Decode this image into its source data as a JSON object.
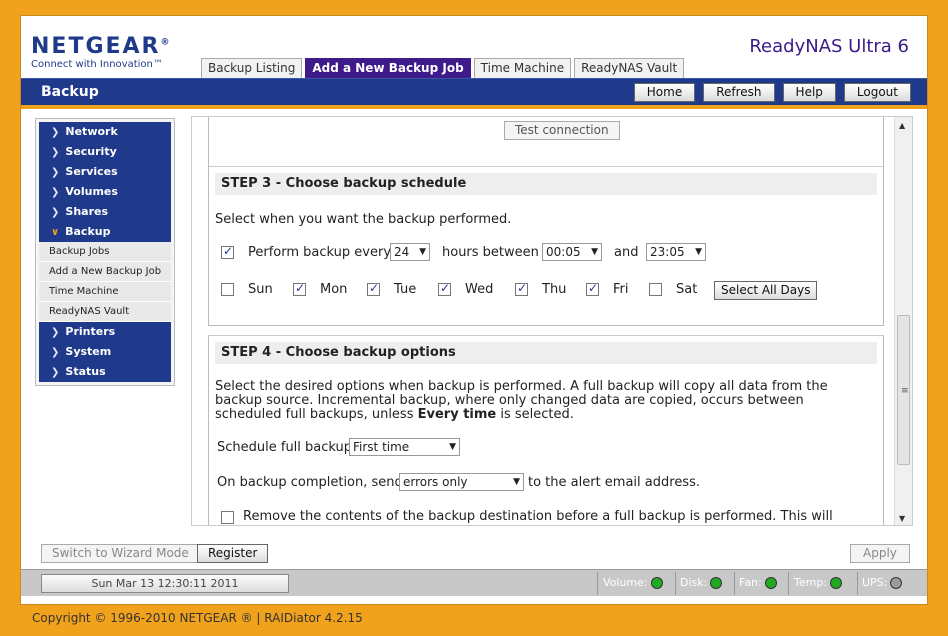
{
  "header": {
    "brand": "NETGEAR",
    "registered": "®",
    "tagline": "Connect with Innovation™",
    "product": "ReadyNAS Ultra 6"
  },
  "tabs": [
    {
      "label": "Backup Listing",
      "active": false
    },
    {
      "label": "Add a New Backup Job",
      "active": true
    },
    {
      "label": "Time Machine",
      "active": false
    },
    {
      "label": "ReadyNAS Vault",
      "active": false
    }
  ],
  "titlebar": {
    "section": "Backup",
    "buttons": [
      "Home",
      "Refresh",
      "Help",
      "Logout"
    ]
  },
  "sidebar": {
    "items": [
      {
        "label": "Network",
        "type": "main"
      },
      {
        "label": "Security",
        "type": "main"
      },
      {
        "label": "Services",
        "type": "main"
      },
      {
        "label": "Volumes",
        "type": "main"
      },
      {
        "label": "Shares",
        "type": "main"
      },
      {
        "label": "Backup",
        "type": "main",
        "open": true
      },
      {
        "label": "Backup Jobs",
        "type": "sub"
      },
      {
        "label": "Add a New Backup Job",
        "type": "sub"
      },
      {
        "label": "Time Machine",
        "type": "sub"
      },
      {
        "label": "ReadyNAS Vault",
        "type": "sub"
      },
      {
        "label": "Printers",
        "type": "main"
      },
      {
        "label": "System",
        "type": "main"
      },
      {
        "label": "Status",
        "type": "main"
      }
    ]
  },
  "test_connection": "Test connection",
  "step3": {
    "title": "STEP 3 - Choose backup schedule",
    "instruction": "Select when you want the backup performed.",
    "perform_label": "Perform backup every",
    "perform_checked": true,
    "interval": "24",
    "hours_between": "hours between",
    "start_time": "00:05",
    "and": "and",
    "end_time": "23:05",
    "days": [
      {
        "label": "Sun",
        "checked": false
      },
      {
        "label": "Mon",
        "checked": true
      },
      {
        "label": "Tue",
        "checked": true
      },
      {
        "label": "Wed",
        "checked": true
      },
      {
        "label": "Thu",
        "checked": true
      },
      {
        "label": "Fri",
        "checked": true
      },
      {
        "label": "Sat",
        "checked": false
      }
    ],
    "select_all": "Select All Days"
  },
  "step4": {
    "title": "STEP 4 - Choose backup options",
    "desc_part1": "Select the desired options when backup is performed. A full backup will copy all data from the backup source. Incremental backup, where only changed data are copied, occurs between scheduled full backups, unless ",
    "desc_bold": "Every time",
    "desc_part2": " is selected.",
    "full_backup_label": "Schedule full backup",
    "full_backup_value": "First time",
    "completion_label": "On backup completion, send",
    "completion_value": "errors only",
    "completion_suffix": "to the alert email address.",
    "remove_label": "Remove the contents of the backup destination before a full backup is performed. This will",
    "remove_checked": false
  },
  "bottom": {
    "wizard": "Switch to Wizard Mode",
    "register": "Register",
    "apply": "Apply"
  },
  "status": {
    "clock": "Sun Mar 13  12:30:11 2011",
    "indicators": [
      {
        "label": "Volume:",
        "color": "#1faa1f"
      },
      {
        "label": "Disk:",
        "color": "#1faa1f"
      },
      {
        "label": "Fan:",
        "color": "#1faa1f"
      },
      {
        "label": "Temp:",
        "color": "#1faa1f"
      },
      {
        "label": "UPS:",
        "color": "#9a9a9a"
      }
    ]
  },
  "footer": {
    "copyright": "Copyright © 1996-2010 NETGEAR ® | RAIDiator 4.2.15"
  }
}
